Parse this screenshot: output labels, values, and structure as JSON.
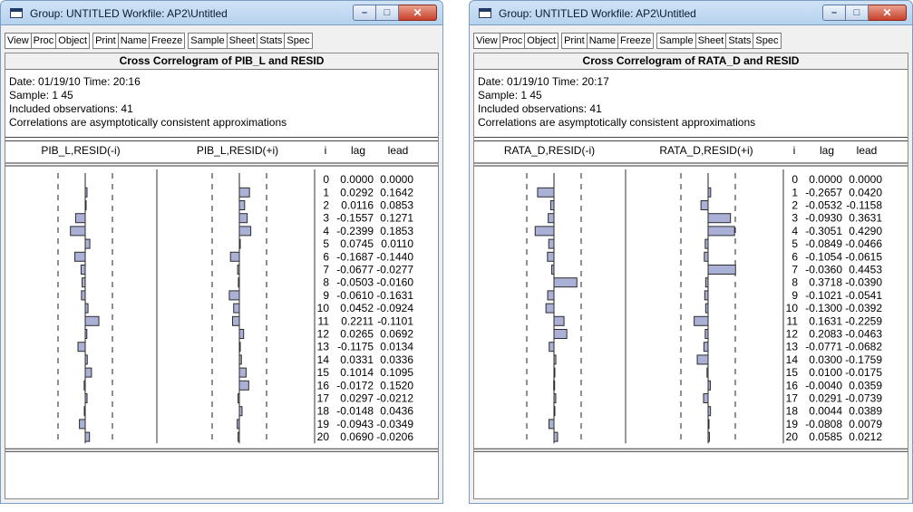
{
  "windows": [
    {
      "title": "Group: UNTITLED   Workfile: AP2\\Untitled",
      "toolbar": [
        "View",
        "Proc",
        "Object",
        "Print",
        "Name",
        "Freeze",
        "Sample",
        "Sheet",
        "Stats",
        "Spec"
      ],
      "heading": "Cross Correlogram of PIB_L and RESID",
      "date_line": "Date: 01/19/10   Time: 20:16",
      "sample_line": "Sample: 1 45",
      "obs_line": "Included observations: 41",
      "note_line": "Correlations are asymptotically consistent approximations",
      "columns": {
        "lag_series": "PIB_L,RESID(-i)",
        "lead_series": "PIB_L,RESID(+i)",
        "i": "i",
        "lag": "lag",
        "lead": "lead"
      },
      "chart_data": {
        "type": "table",
        "i": [
          0,
          1,
          2,
          3,
          4,
          5,
          6,
          7,
          8,
          9,
          10,
          11,
          12,
          13,
          14,
          15,
          16,
          17,
          18,
          19,
          20
        ],
        "lag": [
          "0.0000",
          "0.0292",
          "0.0116",
          "-0.1557",
          "-0.2399",
          "0.0745",
          "-0.1687",
          "-0.0677",
          "-0.0503",
          "-0.0610",
          "0.0452",
          "0.2211",
          "0.0265",
          "-0.1175",
          "0.0331",
          "0.1014",
          "-0.0172",
          "0.0297",
          "-0.0148",
          "-0.0943",
          "0.0690"
        ],
        "lead": [
          "0.0000",
          "0.1642",
          "0.0853",
          "0.1271",
          "0.1853",
          "0.0110",
          "-0.1440",
          "-0.0277",
          "-0.0160",
          "-0.1631",
          "-0.0924",
          "-0.1101",
          "0.0692",
          "0.0134",
          "0.0336",
          "0.1095",
          "0.1520",
          "-0.0212",
          "0.0436",
          "-0.0349",
          "-0.0206"
        ]
      }
    },
    {
      "title": "Group: UNTITLED   Workfile: AP2\\Untitled",
      "toolbar": [
        "View",
        "Proc",
        "Object",
        "Print",
        "Name",
        "Freeze",
        "Sample",
        "Sheet",
        "Stats",
        "Spec"
      ],
      "heading": "Cross Correlogram of RATA_D and RESID",
      "date_line": "Date: 01/19/10   Time: 20:17",
      "sample_line": "Sample: 1 45",
      "obs_line": "Included observations: 41",
      "note_line": "Correlations are asymptotically consistent approximations",
      "columns": {
        "lag_series": "RATA_D,RESID(-i)",
        "lead_series": "RATA_D,RESID(+i)",
        "i": "i",
        "lag": "lag",
        "lead": "lead"
      },
      "chart_data": {
        "type": "table",
        "i": [
          0,
          1,
          2,
          3,
          4,
          5,
          6,
          7,
          8,
          9,
          10,
          11,
          12,
          13,
          14,
          15,
          16,
          17,
          18,
          19,
          20
        ],
        "lag": [
          "0.0000",
          "-0.2657",
          "-0.0532",
          "-0.0930",
          "-0.3051",
          "-0.0849",
          "-0.1054",
          "-0.0360",
          "0.3718",
          "-0.1021",
          "-0.1300",
          "0.1631",
          "0.2083",
          "-0.0771",
          "0.0300",
          "0.0100",
          "-0.0040",
          "0.0291",
          "0.0044",
          "-0.0808",
          "0.0585"
        ],
        "lead": [
          "0.0000",
          "0.0420",
          "-0.1158",
          "0.3631",
          "0.4290",
          "-0.0466",
          "-0.0615",
          "0.4453",
          "-0.0390",
          "-0.0541",
          "-0.0392",
          "-0.2259",
          "-0.0463",
          "-0.0682",
          "-0.1759",
          "-0.0175",
          "0.0359",
          "-0.0739",
          "0.0389",
          "0.0079",
          "0.0212"
        ]
      }
    }
  ],
  "colors": {
    "bar_fill": "#aab0d6",
    "bar_stroke": "#2c2c2c",
    "titlebar": "#c4daf2",
    "close_button": "#c7412b"
  },
  "icons": {
    "title": "window-app-icon",
    "minimize": "minimize-icon",
    "maximize": "maximize-icon",
    "close": "close-icon"
  }
}
